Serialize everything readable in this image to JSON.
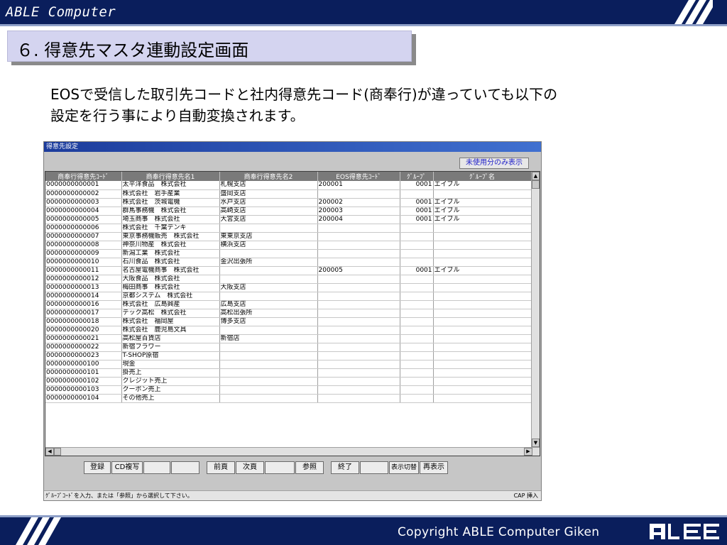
{
  "header": {
    "brand": "ABLE Computer"
  },
  "heading": "６. 得意先マスタ連動設定画面",
  "description": {
    "line1": "EOSで受信した取引先コードと社内得意先コード(商奉行)が違っていても以下の",
    "line2": "設定を行う事により自動変換されます。"
  },
  "window": {
    "title": "得意先設定",
    "unused_button": "未使用分のみ表示",
    "columns": [
      "商奉行得意先ｺｰﾄﾞ",
      "商奉行得意先名1",
      "商奉行得意先名2",
      "EOS得意先ｺｰﾄﾞ",
      "ｸﾞﾙｰﾌﾟ",
      "ｸﾞﾙｰﾌﾟ名"
    ],
    "rows": [
      [
        "0000000000001",
        "太平洋食品　株式会社",
        "札幌支店",
        "200001",
        "0001",
        "エイブル"
      ],
      [
        "0000000000002",
        "株式会社　岩手産業",
        "盛岡支店",
        "",
        "",
        ""
      ],
      [
        "0000000000003",
        "株式会社　茨城電機",
        "水戸支店",
        "200002",
        "0001",
        "エイブル"
      ],
      [
        "0000000000004",
        "群馬事務機　株式会社",
        "高崎支店",
        "200003",
        "0001",
        "エイブル"
      ],
      [
        "0000000000005",
        "埼玉商事　株式会社",
        "大宮支店",
        "200004",
        "0001",
        "エイブル"
      ],
      [
        "0000000000006",
        "株式会社　千葉デンキ",
        "",
        "",
        "",
        ""
      ],
      [
        "0000000000007",
        "東京事務機販売　株式会社",
        "東東京支店",
        "",
        "",
        ""
      ],
      [
        "0000000000008",
        "神奈川物産　株式会社",
        "横浜支店",
        "",
        "",
        ""
      ],
      [
        "0000000000009",
        "新潟工業　株式会社",
        "",
        "",
        "",
        ""
      ],
      [
        "0000000000010",
        "石川食品　株式会社",
        "金沢出張所",
        "",
        "",
        ""
      ],
      [
        "0000000000011",
        "名古屋電機商事　株式会社",
        "",
        "200005",
        "0001",
        "エイブル"
      ],
      [
        "0000000000012",
        "大阪食品　株式会社",
        "",
        "",
        "",
        ""
      ],
      [
        "0000000000013",
        "梅田商事　株式会社",
        "大阪支店",
        "",
        "",
        ""
      ],
      [
        "0000000000014",
        "京都システム　株式会社",
        "",
        "",
        "",
        ""
      ],
      [
        "0000000000016",
        "株式会社　広島興産",
        "広島支店",
        "",
        "",
        ""
      ],
      [
        "0000000000017",
        "テック高松　株式会社",
        "高松出張所",
        "",
        "",
        ""
      ],
      [
        "0000000000018",
        "株式会社　福岡屋",
        "博多支店",
        "",
        "",
        ""
      ],
      [
        "0000000000020",
        "株式会社　鹿児島文具",
        "",
        "",
        "",
        ""
      ],
      [
        "0000000000021",
        "高松屋百貨店",
        "新宿店",
        "",
        "",
        ""
      ],
      [
        "0000000000022",
        "新宿フラワー",
        "",
        "",
        "",
        ""
      ],
      [
        "0000000000023",
        "T-SHOP原宿",
        "",
        "",
        "",
        ""
      ],
      [
        "0000000000100",
        "現金",
        "",
        "",
        "",
        ""
      ],
      [
        "0000000000101",
        "掛売上",
        "",
        "",
        "",
        ""
      ],
      [
        "0000000000102",
        "クレジット売上",
        "",
        "",
        "",
        ""
      ],
      [
        "0000000000103",
        "クーポン売上",
        "",
        "",
        "",
        ""
      ],
      [
        "0000000000104",
        "その他売上",
        "",
        "",
        "",
        ""
      ]
    ],
    "buttons": {
      "register": "登録",
      "cd_copy": "CD複写",
      "prev_page": "前頁",
      "next_page": "次頁",
      "reference": "参照",
      "exit": "終了",
      "display_toggle": "表示切替",
      "redisplay": "再表示"
    },
    "status_text": "ｸﾞﾙｰﾌﾟｺｰﾄﾞを入力、または「参照」から選択して下さい。",
    "status_indicator": "CAP 挿入"
  },
  "footer": {
    "copyright": "Copyright ABLE Computer Giken",
    "logo_text": "ABLE"
  },
  "colors": {
    "banner": "#0a1e5c",
    "heading_bg": "#d4d4f0",
    "link_blue": "#1c1cc8"
  }
}
